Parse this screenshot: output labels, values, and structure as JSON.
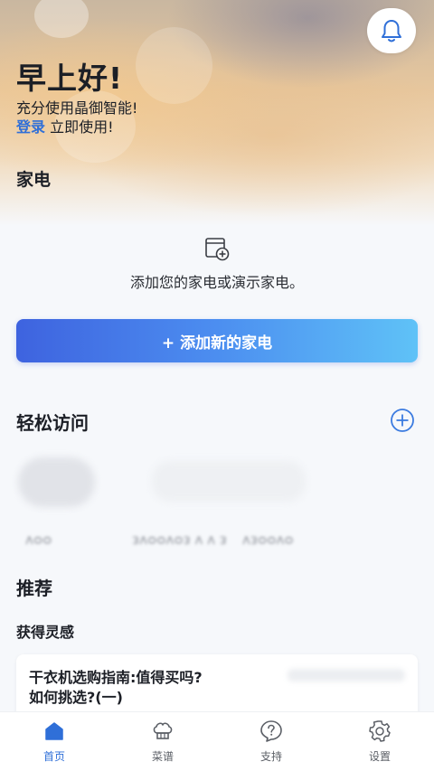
{
  "header": {
    "greeting": "早上好!",
    "subtitle": "充分使用晶御智能!",
    "login_link": "登录",
    "login_suffix": " 立即使用!"
  },
  "appliances": {
    "title": "家电",
    "empty_text": "添加您的家电或演示家电。",
    "add_button": "+ 添加新的家电"
  },
  "easy_access": {
    "title": "轻松访问",
    "items": [
      "ᴧᴑᴑ",
      "ᴈᴧᴑᴑᴧᴑᴈ ᴧ ᴧ ᴈ",
      "ᴧᴈᴑᴑᴧᴑ"
    ]
  },
  "recommend": {
    "title": "推荐",
    "subtitle": "获得灵感",
    "card_line1": "干衣机选购指南:值得买吗?",
    "card_line2": "如何挑选?(一)"
  },
  "bottom_nav": {
    "items": [
      {
        "label": "首页",
        "icon": "home-icon",
        "active": true
      },
      {
        "label": "菜谱",
        "icon": "chef-hat-icon",
        "active": false
      },
      {
        "label": "支持",
        "icon": "help-icon",
        "active": false
      },
      {
        "label": "设置",
        "icon": "gear-icon",
        "active": false
      }
    ]
  },
  "colors": {
    "accent": "#2f6fd8",
    "button_gradient_start": "#3e63df",
    "button_gradient_end": "#5fc2f7"
  }
}
